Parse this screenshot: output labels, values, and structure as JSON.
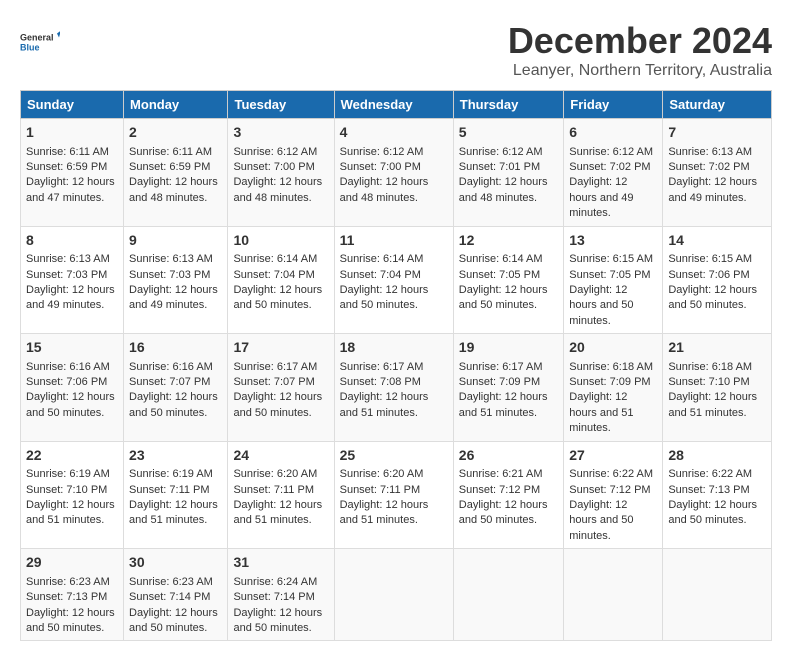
{
  "logo": {
    "line1": "General",
    "line2": "Blue"
  },
  "title": "December 2024",
  "subtitle": "Leanyer, Northern Territory, Australia",
  "days_header": [
    "Sunday",
    "Monday",
    "Tuesday",
    "Wednesday",
    "Thursday",
    "Friday",
    "Saturday"
  ],
  "weeks": [
    [
      {
        "day": "1",
        "sunrise": "6:11 AM",
        "sunset": "6:59 PM",
        "daylight": "12 hours and 47 minutes."
      },
      {
        "day": "2",
        "sunrise": "6:11 AM",
        "sunset": "6:59 PM",
        "daylight": "12 hours and 48 minutes."
      },
      {
        "day": "3",
        "sunrise": "6:12 AM",
        "sunset": "7:00 PM",
        "daylight": "12 hours and 48 minutes."
      },
      {
        "day": "4",
        "sunrise": "6:12 AM",
        "sunset": "7:00 PM",
        "daylight": "12 hours and 48 minutes."
      },
      {
        "day": "5",
        "sunrise": "6:12 AM",
        "sunset": "7:01 PM",
        "daylight": "12 hours and 48 minutes."
      },
      {
        "day": "6",
        "sunrise": "6:12 AM",
        "sunset": "7:02 PM",
        "daylight": "12 hours and 49 minutes."
      },
      {
        "day": "7",
        "sunrise": "6:13 AM",
        "sunset": "7:02 PM",
        "daylight": "12 hours and 49 minutes."
      }
    ],
    [
      {
        "day": "8",
        "sunrise": "6:13 AM",
        "sunset": "7:03 PM",
        "daylight": "12 hours and 49 minutes."
      },
      {
        "day": "9",
        "sunrise": "6:13 AM",
        "sunset": "7:03 PM",
        "daylight": "12 hours and 49 minutes."
      },
      {
        "day": "10",
        "sunrise": "6:14 AM",
        "sunset": "7:04 PM",
        "daylight": "12 hours and 50 minutes."
      },
      {
        "day": "11",
        "sunrise": "6:14 AM",
        "sunset": "7:04 PM",
        "daylight": "12 hours and 50 minutes."
      },
      {
        "day": "12",
        "sunrise": "6:14 AM",
        "sunset": "7:05 PM",
        "daylight": "12 hours and 50 minutes."
      },
      {
        "day": "13",
        "sunrise": "6:15 AM",
        "sunset": "7:05 PM",
        "daylight": "12 hours and 50 minutes."
      },
      {
        "day": "14",
        "sunrise": "6:15 AM",
        "sunset": "7:06 PM",
        "daylight": "12 hours and 50 minutes."
      }
    ],
    [
      {
        "day": "15",
        "sunrise": "6:16 AM",
        "sunset": "7:06 PM",
        "daylight": "12 hours and 50 minutes."
      },
      {
        "day": "16",
        "sunrise": "6:16 AM",
        "sunset": "7:07 PM",
        "daylight": "12 hours and 50 minutes."
      },
      {
        "day": "17",
        "sunrise": "6:17 AM",
        "sunset": "7:07 PM",
        "daylight": "12 hours and 50 minutes."
      },
      {
        "day": "18",
        "sunrise": "6:17 AM",
        "sunset": "7:08 PM",
        "daylight": "12 hours and 51 minutes."
      },
      {
        "day": "19",
        "sunrise": "6:17 AM",
        "sunset": "7:09 PM",
        "daylight": "12 hours and 51 minutes."
      },
      {
        "day": "20",
        "sunrise": "6:18 AM",
        "sunset": "7:09 PM",
        "daylight": "12 hours and 51 minutes."
      },
      {
        "day": "21",
        "sunrise": "6:18 AM",
        "sunset": "7:10 PM",
        "daylight": "12 hours and 51 minutes."
      }
    ],
    [
      {
        "day": "22",
        "sunrise": "6:19 AM",
        "sunset": "7:10 PM",
        "daylight": "12 hours and 51 minutes."
      },
      {
        "day": "23",
        "sunrise": "6:19 AM",
        "sunset": "7:11 PM",
        "daylight": "12 hours and 51 minutes."
      },
      {
        "day": "24",
        "sunrise": "6:20 AM",
        "sunset": "7:11 PM",
        "daylight": "12 hours and 51 minutes."
      },
      {
        "day": "25",
        "sunrise": "6:20 AM",
        "sunset": "7:11 PM",
        "daylight": "12 hours and 51 minutes."
      },
      {
        "day": "26",
        "sunrise": "6:21 AM",
        "sunset": "7:12 PM",
        "daylight": "12 hours and 50 minutes."
      },
      {
        "day": "27",
        "sunrise": "6:22 AM",
        "sunset": "7:12 PM",
        "daylight": "12 hours and 50 minutes."
      },
      {
        "day": "28",
        "sunrise": "6:22 AM",
        "sunset": "7:13 PM",
        "daylight": "12 hours and 50 minutes."
      }
    ],
    [
      {
        "day": "29",
        "sunrise": "6:23 AM",
        "sunset": "7:13 PM",
        "daylight": "12 hours and 50 minutes."
      },
      {
        "day": "30",
        "sunrise": "6:23 AM",
        "sunset": "7:14 PM",
        "daylight": "12 hours and 50 minutes."
      },
      {
        "day": "31",
        "sunrise": "6:24 AM",
        "sunset": "7:14 PM",
        "daylight": "12 hours and 50 minutes."
      },
      null,
      null,
      null,
      null
    ]
  ]
}
